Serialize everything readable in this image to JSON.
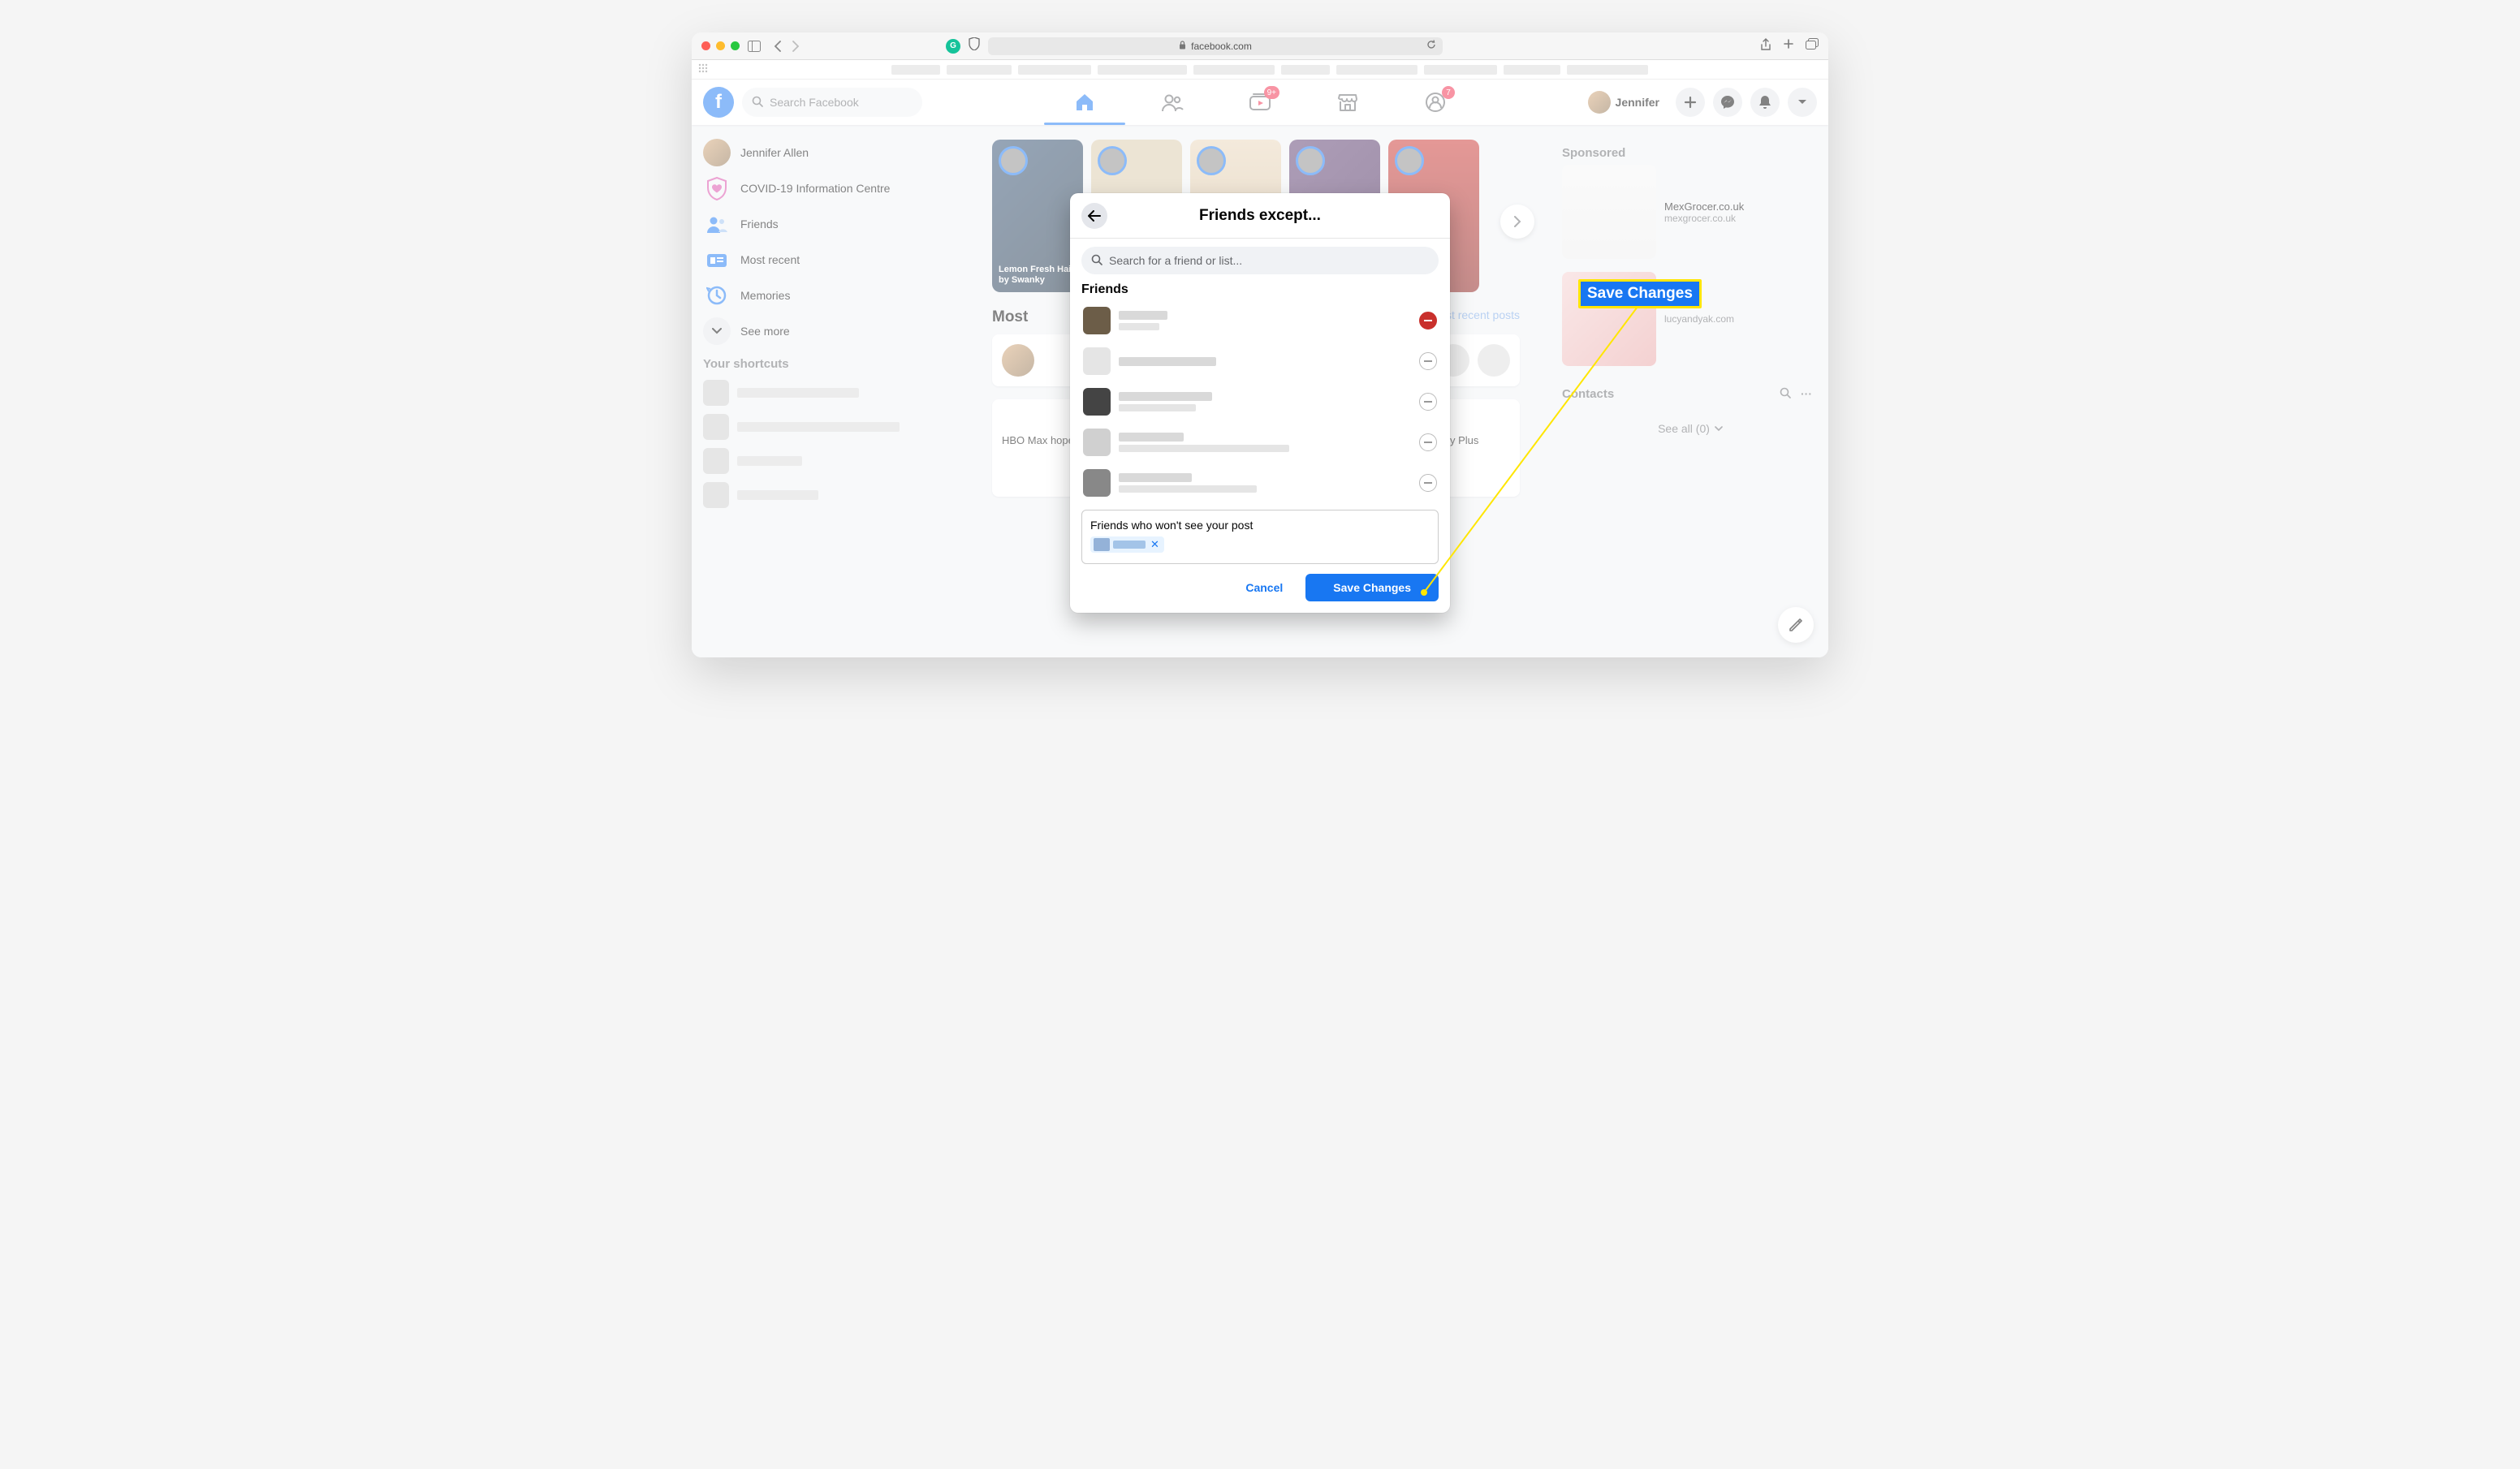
{
  "browser": {
    "url_label": "facebook.com"
  },
  "fb_nav": {
    "search_placeholder": "Search Facebook",
    "watch_badge": "9+",
    "groups_badge": "7",
    "user_name": "Jennifer"
  },
  "left": {
    "items": [
      {
        "label": "Jennifer Allen"
      },
      {
        "label": "COVID-19 Information Centre"
      },
      {
        "label": "Friends"
      },
      {
        "label": "Most recent"
      },
      {
        "label": "Memories"
      },
      {
        "label": "See more"
      }
    ],
    "shortcuts_header": "Your shortcuts"
  },
  "right": {
    "sponsored_header": "Sponsored",
    "sponsors": [
      {
        "title": "MexGrocer.co.uk",
        "url": "mexgrocer.co.uk"
      },
      {
        "title": "",
        "url": "lucyandyak.com"
      }
    ],
    "contacts_header": "Contacts",
    "see_all": "See all (0)"
  },
  "feed": {
    "most_recent_label": "Most recent posts",
    "story_label_1": "Lemon Fresh Hair by Swanky",
    "post_text": "HBO Max hopes to release multiple new Game of Thrones shows, similar to Star Wars on Disney Plus"
  },
  "modal": {
    "title": "Friends except...",
    "search_placeholder": "Search for a friend or list...",
    "friends_label": "Friends",
    "exclude_label": "Friends who won't see your post",
    "cancel": "Cancel",
    "save": "Save Changes"
  },
  "annotation": {
    "label": "Save Changes"
  }
}
